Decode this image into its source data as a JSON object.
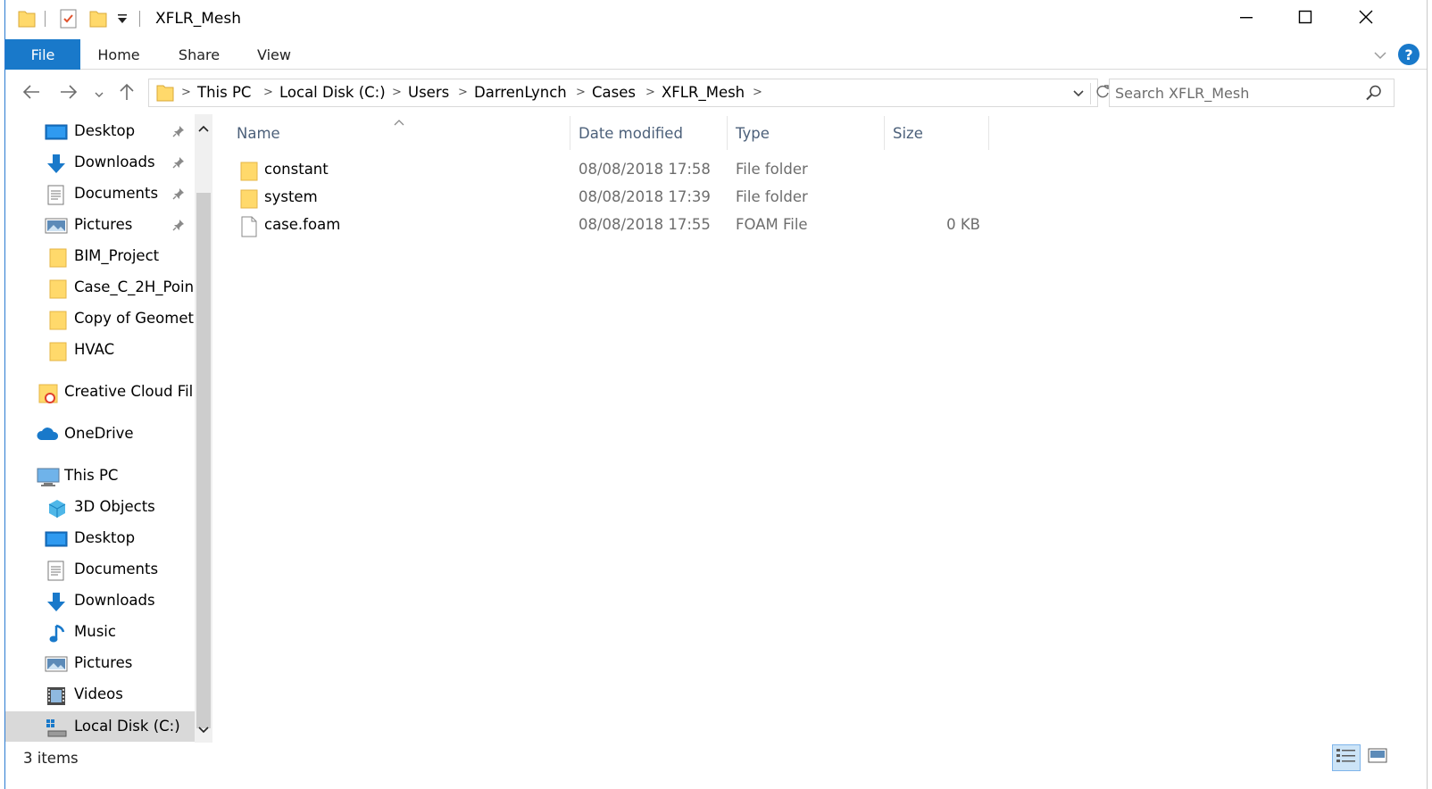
{
  "window": {
    "title": "XFLR_Mesh"
  },
  "ribbon": {
    "tabs": [
      {
        "label": "File"
      },
      {
        "label": "Home"
      },
      {
        "label": "Share"
      },
      {
        "label": "View"
      }
    ],
    "help_label": "?"
  },
  "address": {
    "breadcrumbs": [
      "This PC",
      "Local Disk (C:)",
      "Users",
      "DarrenLynch",
      "Cases",
      "XFLR_Mesh"
    ]
  },
  "search": {
    "placeholder": "Search XFLR_Mesh"
  },
  "sidebar": {
    "items": [
      {
        "label": "Desktop",
        "icon": "desktop-icon",
        "pinned": true
      },
      {
        "label": "Downloads",
        "icon": "downloads-icon",
        "pinned": true
      },
      {
        "label": "Documents",
        "icon": "documents-icon",
        "pinned": true
      },
      {
        "label": "Pictures",
        "icon": "pictures-icon",
        "pinned": true
      },
      {
        "label": "BIM_Project",
        "icon": "folder-icon"
      },
      {
        "label": "Case_C_2H_Poin",
        "icon": "folder-icon"
      },
      {
        "label": "Copy of Geomet",
        "icon": "folder-icon"
      },
      {
        "label": "HVAC",
        "icon": "folder-icon"
      },
      {
        "label": "Creative Cloud Fil",
        "icon": "creative-cloud-icon"
      },
      {
        "label": "OneDrive",
        "icon": "onedrive-icon"
      },
      {
        "label": "This PC",
        "icon": "this-pc-icon"
      },
      {
        "label": "3D Objects",
        "icon": "3d-objects-icon"
      },
      {
        "label": "Desktop",
        "icon": "desktop-icon"
      },
      {
        "label": "Documents",
        "icon": "documents-icon"
      },
      {
        "label": "Downloads",
        "icon": "downloads-icon"
      },
      {
        "label": "Music",
        "icon": "music-icon"
      },
      {
        "label": "Pictures",
        "icon": "pictures-icon"
      },
      {
        "label": "Videos",
        "icon": "videos-icon"
      },
      {
        "label": "Local Disk (C:)",
        "icon": "local-disk-icon",
        "selected": true
      }
    ]
  },
  "filelist": {
    "columns": [
      "Name",
      "Date modified",
      "Type",
      "Size"
    ],
    "rows": [
      {
        "name": "constant",
        "date": "08/08/2018 17:58",
        "type": "File folder",
        "size": "",
        "icon": "folder-icon"
      },
      {
        "name": "system",
        "date": "08/08/2018 17:39",
        "type": "File folder",
        "size": "",
        "icon": "folder-icon"
      },
      {
        "name": "case.foam",
        "date": "08/08/2018 17:55",
        "type": "FOAM File",
        "size": "0 KB",
        "icon": "file-icon"
      }
    ]
  },
  "status": {
    "item_count": "3 items"
  },
  "colors": {
    "accent": "#1979ca",
    "folder": "#ffd96b",
    "header_text": "#4c607a",
    "secondary_text": "#6d6d6d"
  }
}
